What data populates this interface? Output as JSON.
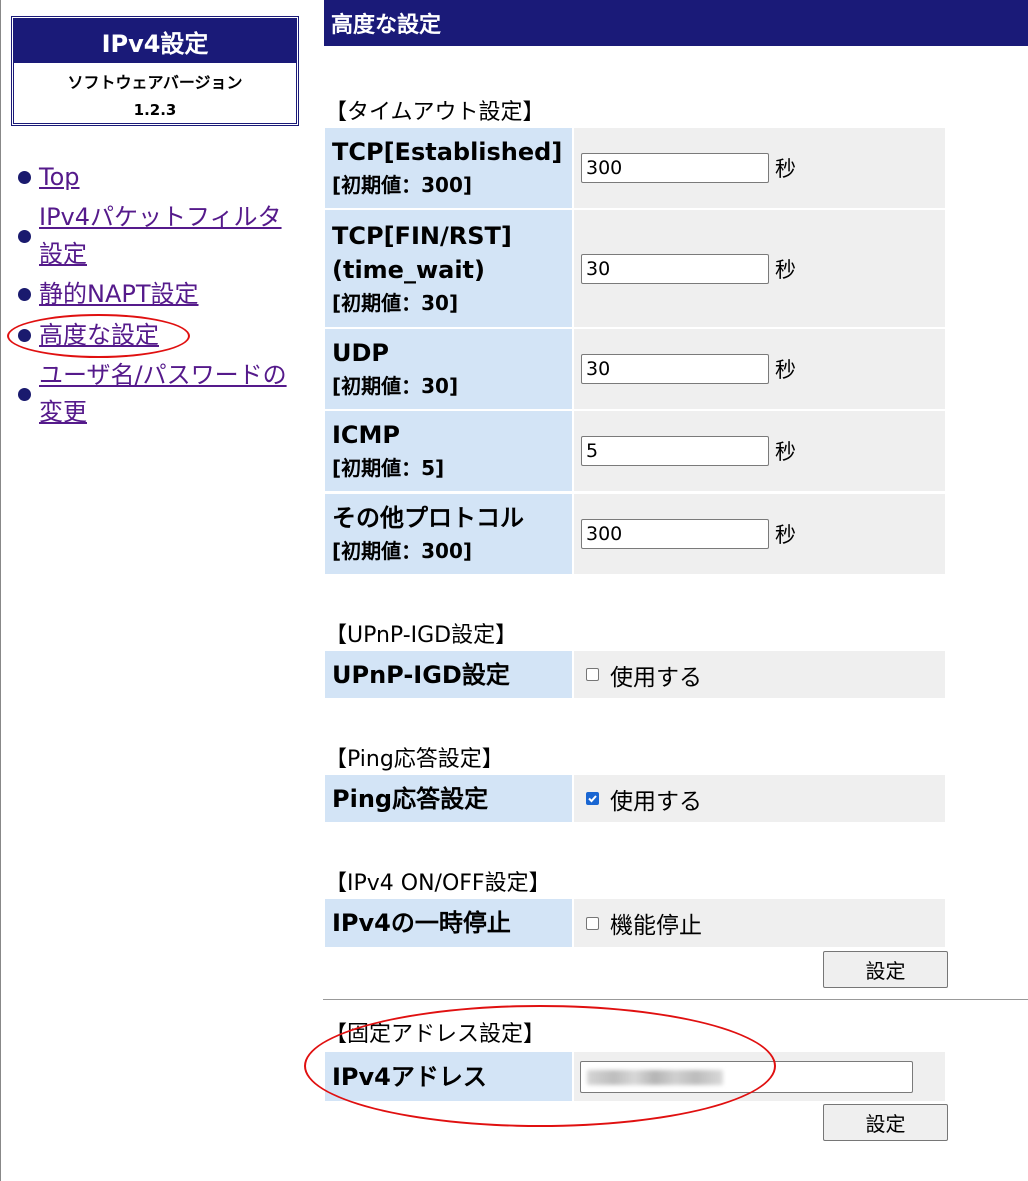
{
  "sidebar": {
    "title": "IPv4設定",
    "version_label": "ソフトウェアバージョン",
    "version": "1.2.3",
    "nav": [
      {
        "label": "Top"
      },
      {
        "label_line1": "IPv4パケットフィルタ",
        "label_line2": "設定"
      },
      {
        "label": "静的NAPT設定"
      },
      {
        "label": "高度な設定"
      },
      {
        "label_line1": "ユーザ名/パスワードの",
        "label_line2": "変更"
      }
    ]
  },
  "header": {
    "title": "高度な設定"
  },
  "timeout": {
    "section_title": "【タイムアウト設定】",
    "unit": "秒",
    "rows": [
      {
        "label": "TCP[Established]",
        "default": "[初期値：300]",
        "value": "300"
      },
      {
        "label_line1": "TCP[FIN/RST]",
        "label_line2": "(time_wait)",
        "default": "[初期値：30]",
        "value": "30"
      },
      {
        "label": "UDP",
        "default": "[初期値：30]",
        "value": "30"
      },
      {
        "label": "ICMP",
        "default": "[初期値：5]",
        "value": "5"
      },
      {
        "label": "その他プロトコル",
        "default": "[初期値：300]",
        "value": "300"
      }
    ]
  },
  "upnp": {
    "section_title": "【UPnP-IGD設定】",
    "label": "UPnP-IGD設定",
    "checkbox_label": "使用する",
    "checked": false
  },
  "ping": {
    "section_title": "【Ping応答設定】",
    "label": "Ping応答設定",
    "checkbox_label": "使用する",
    "checked": true
  },
  "ipv4onoff": {
    "section_title": "【IPv4 ON/OFF設定】",
    "label": "IPv4の一時停止",
    "checkbox_label": "機能停止",
    "checked": false
  },
  "submit_label": "設定",
  "fixed_address": {
    "section_title": "【固定アドレス設定】",
    "label": "IPv4アドレス",
    "submit_label": "設定"
  },
  "colors": {
    "header_bg": "#1a1a78",
    "label_bg": "#d3e4f6",
    "value_bg": "#efefef",
    "annotation": "#e01010",
    "link": "#551a8b"
  }
}
